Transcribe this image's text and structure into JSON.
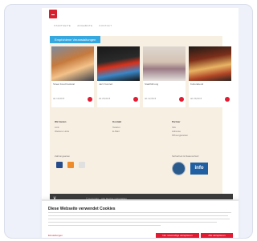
{
  "nav": {
    "items": [
      "STARTSEITE",
      "ANGEBOTE",
      "KONTAKT"
    ]
  },
  "banner": {
    "tag": "Empfohlene Veranstaltungen"
  },
  "cards": [
    {
      "title": "Street Food Festival",
      "meta": "ab 19,00 €"
    },
    {
      "title": "Jazz Konzert",
      "meta": "ab 25,00 €"
    },
    {
      "title": "Stadtführung",
      "meta": "ab 12,00 €"
    },
    {
      "title": "Kulturabend",
      "meta": "ab 29,00 €"
    }
  ],
  "footer": {
    "col1": {
      "heading": "Wir bieten",
      "items": [
        "Link",
        "Weitere Links"
      ]
    },
    "col2": {
      "heading": "Kontakt",
      "items": [
        "Telefon",
        "E-Mail"
      ]
    },
    "col3": {
      "heading": "Partner",
      "items": [
        "Info",
        "Adresse",
        "Öffnungszeiten"
      ]
    },
    "payments_heading": "Zahlungsarten",
    "security_heading": "Sicherheit & Datenschutz",
    "security_badge": "info"
  },
  "darkbar": {
    "text": "© Copyright – Alle Rechte vorbehalten"
  },
  "cookie": {
    "title": "Diese Webseite verwendet Cookies",
    "settings_link": "Einstellungen",
    "btn_accept_necessary": "Nur notwendige akzeptieren",
    "btn_accept_all": "Alle akzeptieren"
  }
}
